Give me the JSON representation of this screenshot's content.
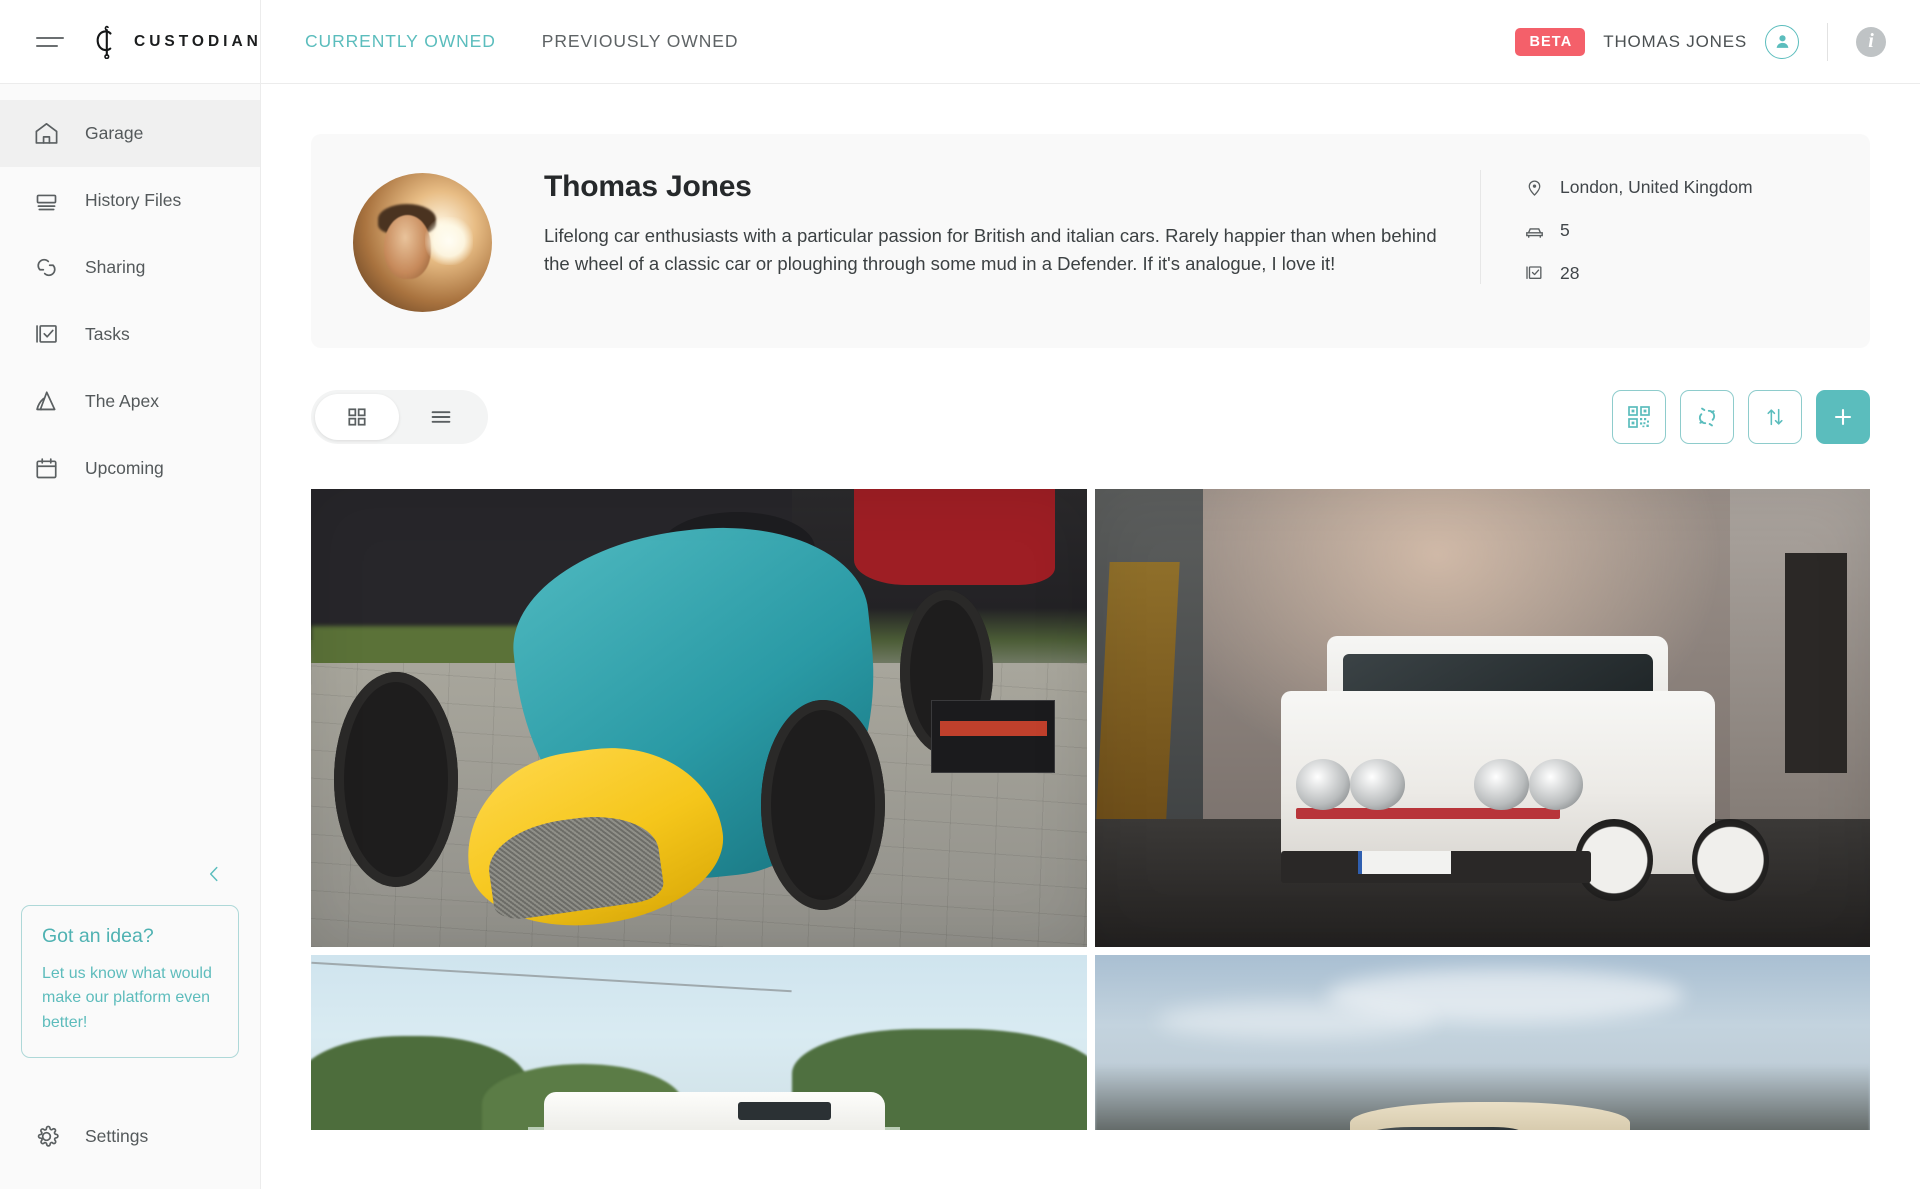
{
  "brand": {
    "name": "CUSTODIAN",
    "logo_icon": "custodian-monogram-icon",
    "menu_icon": "hamburger-icon"
  },
  "topbar": {
    "tabs": [
      {
        "label": "CURRENTLY OWNED",
        "active": true
      },
      {
        "label": "PREVIOUSLY OWNED",
        "active": false
      }
    ],
    "beta_badge": "BETA",
    "user_name": "THOMAS JONES",
    "avatar_icon": "user-avatar-icon",
    "info_icon": "info-icon"
  },
  "sidebar": {
    "items": [
      {
        "label": "Garage",
        "icon": "home-icon",
        "active": true
      },
      {
        "label": "History Files",
        "icon": "files-icon",
        "active": false
      },
      {
        "label": "Sharing",
        "icon": "link-share-icon",
        "active": false
      },
      {
        "label": "Tasks",
        "icon": "checkbox-task-icon",
        "active": false
      },
      {
        "label": "The Apex",
        "icon": "apex-mountain-icon",
        "active": false
      },
      {
        "label": "Upcoming",
        "icon": "calendar-icon",
        "active": false
      }
    ],
    "collapse_icon": "chevron-left-icon",
    "idea_card": {
      "title": "Got an idea?",
      "body": "Let us know what would make our platform even better!"
    },
    "settings": {
      "label": "Settings",
      "icon": "gear-icon"
    }
  },
  "profile": {
    "name": "Thomas Jones",
    "bio": "Lifelong car enthusiasts with a particular passion for British and italian cars. Rarely happier than when behind the wheel of a classic car or ploughing through some mud in a Defender. If it's analogue, I love it!",
    "avatar_alt": "profile-photo",
    "stats": [
      {
        "icon": "location-pin-icon",
        "value": "London, United Kingdom"
      },
      {
        "icon": "car-icon",
        "value": "5"
      },
      {
        "icon": "checkbox-task-icon",
        "value": "28"
      }
    ]
  },
  "toolbar": {
    "views": [
      {
        "name": "grid-view",
        "icon": "grid-icon",
        "active": true
      },
      {
        "name": "list-view",
        "icon": "list-icon",
        "active": false
      }
    ],
    "actions": [
      {
        "name": "qr-code-button",
        "icon": "qr-code-icon",
        "primary": false
      },
      {
        "name": "share-link-button",
        "icon": "broken-link-icon",
        "primary": false
      },
      {
        "name": "sort-button",
        "icon": "sort-arrows-icon",
        "primary": false
      },
      {
        "name": "add-vehicle-button",
        "icon": "plus-icon",
        "primary": true
      }
    ]
  },
  "garage": {
    "tiles": [
      {
        "name": "vehicle-tile-vintage-single-seater",
        "alt": "Teal and yellow vintage single-seater racing car on paving"
      },
      {
        "name": "vehicle-tile-vw-golf-gti",
        "alt": "White Volkswagen Golf GTI Mk2 in a concrete yard"
      },
      {
        "name": "vehicle-tile-land-rover-defender",
        "alt": "Green and white Land Rover Defender on a country road"
      },
      {
        "name": "vehicle-tile-classic-saloon",
        "alt": "Classic cream saloon car under a cloudy sky"
      }
    ]
  },
  "colors": {
    "accent": "#5bbdbd",
    "badge": "#f4606a",
    "text": "#3d4142",
    "sidebar_bg": "#fafafa",
    "card_bg": "#f9f9f9"
  }
}
